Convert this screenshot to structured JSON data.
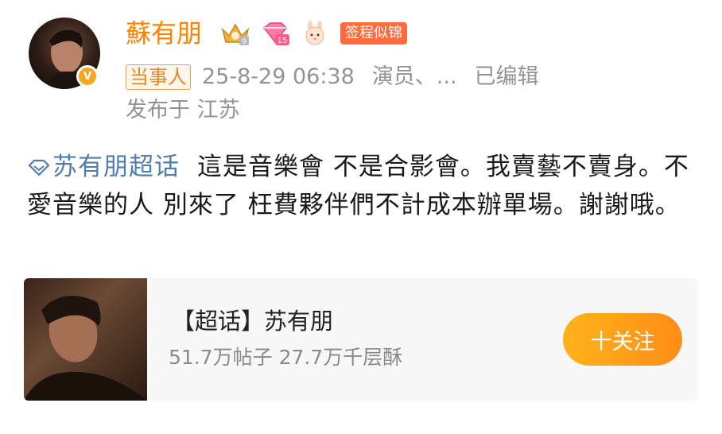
{
  "post": {
    "author": {
      "name": "蘇有朋",
      "verified_icon": "v-verified-icon",
      "badges": [
        {
          "icon": "crown-member-icon"
        },
        {
          "icon": "diamond-level-icon",
          "level": "15"
        },
        {
          "icon": "cute-bunny-icon"
        }
      ],
      "tag": "签程似锦"
    },
    "meta": {
      "role": "当事人",
      "time": "25-8-29 06:38",
      "source": "演员、...",
      "edited": "已编辑"
    },
    "location": "发布于 江苏",
    "content": {
      "topic": "苏有朋超话",
      "text": "這是音樂會 不是合影會。我賣藝不賣身。不愛音樂的人 別來了 枉費夥伴們不計成本辦單場。謝謝哦。"
    },
    "card": {
      "title": "【超话】苏有朋",
      "stats": "51.7万帖子 27.7万千层酥",
      "follow_label": "十关注"
    }
  },
  "colors": {
    "accent_orange": "#ff8200",
    "link_blue": "#507daf",
    "meta_gray": "#939393",
    "tag_red": "#ff6a3d"
  }
}
